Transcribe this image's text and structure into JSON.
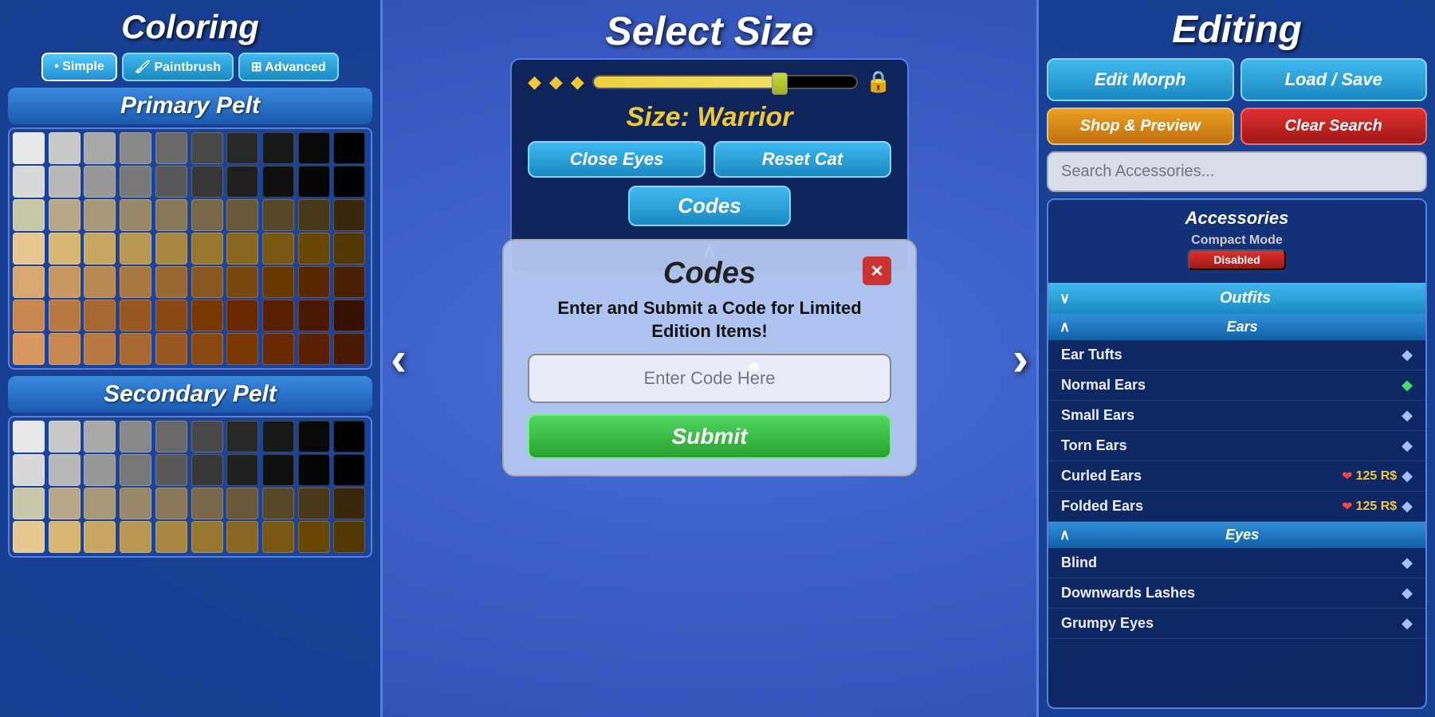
{
  "left_panel": {
    "title": "Coloring",
    "buttons": [
      {
        "label": "• Simple",
        "active": true
      },
      {
        "label": "🖌 Paintbrush",
        "active": false
      },
      {
        "label": "⊞ Advanced",
        "active": false
      }
    ],
    "primary_pelt": {
      "title": "Primary Pelt",
      "colors": [
        "#e8e8e8",
        "#c8c8c8",
        "#a8a8a8",
        "#888",
        "#686868",
        "#484848",
        "#282828",
        "#181818",
        "#080808",
        "#000",
        "#d8d8d8",
        "#b8b8b8",
        "#989898",
        "#787878",
        "#585858",
        "#383838",
        "#202020",
        "#101010",
        "#050505",
        "#000",
        "#c8c8a8",
        "#b8a888",
        "#a89878",
        "#988868",
        "#887858",
        "#786848",
        "#685838",
        "#584828",
        "#483818",
        "#382808",
        "#e8c890",
        "#d8b870",
        "#c8a860",
        "#b89850",
        "#a88840",
        "#987830",
        "#886820",
        "#785810",
        "#684800",
        "#503800",
        "#d8a870",
        "#c89860",
        "#b88850",
        "#a87840",
        "#986830",
        "#885820",
        "#784810",
        "#683800",
        "#582800",
        "#482000",
        "#c88850",
        "#b87840",
        "#a86830",
        "#985820",
        "#884810",
        "#783800",
        "#682800",
        "#582000",
        "#481800",
        "#381000",
        "#d89860",
        "#c88850",
        "#b87840",
        "#a86830",
        "#985820",
        "#884810",
        "#783800",
        "#682800",
        "#582000",
        "#481800"
      ]
    },
    "secondary_pelt": {
      "title": "Secondary Pelt",
      "colors": [
        "#e8e8e8",
        "#c8c8c8",
        "#a8a8a8",
        "#888",
        "#686868",
        "#484848",
        "#282828",
        "#181818",
        "#080808",
        "#000",
        "#d8d8d8",
        "#b8b8b8",
        "#989898",
        "#787878",
        "#585858",
        "#383838",
        "#202020",
        "#101010",
        "#050505",
        "#000"
      ]
    }
  },
  "center_panel": {
    "select_size_title": "Select Size",
    "size_label": "Size: Warrior",
    "close_eyes_btn": "Close Eyes",
    "reset_cat_btn": "Reset Cat",
    "codes_btn": "Codes",
    "collapse_arrow": "∧"
  },
  "codes_modal": {
    "title": "Codes",
    "description": "Enter and Submit a Code for Limited Edition Items!",
    "input_placeholder": "Enter Code Here",
    "submit_btn": "Submit",
    "close_btn": "✕"
  },
  "right_panel": {
    "title": "Editing",
    "edit_morph_btn": "Edit Morph",
    "load_save_btn": "Load / Save",
    "shop_preview_btn": "Shop & Preview",
    "clear_search_btn": "Clear Search",
    "search_placeholder": "Search Accessories...",
    "accessories": {
      "title": "Accessories",
      "compact_mode_label": "Compact Mode",
      "compact_mode_status": "Disabled",
      "categories": [
        {
          "label": "Outfits",
          "expanded": true,
          "arrow": "∨"
        },
        {
          "label": "Ears",
          "expanded": true,
          "arrow": "∧",
          "items": [
            {
              "name": "Ear Tufts",
              "icon": "diamond",
              "owned": false
            },
            {
              "name": "Normal Ears",
              "icon": "diamond-green",
              "owned": true
            },
            {
              "name": "Small Ears",
              "icon": "diamond",
              "owned": false
            },
            {
              "name": "Torn Ears",
              "icon": "diamond",
              "owned": false
            },
            {
              "name": "Curled Ears",
              "icon": "diamond",
              "owned": false,
              "price": "125 R$",
              "locked": true
            },
            {
              "name": "Folded Ears",
              "icon": "diamond",
              "owned": false,
              "price": "125 R$",
              "locked": true
            }
          ]
        },
        {
          "label": "Eyes",
          "expanded": true,
          "arrow": "∧",
          "items": [
            {
              "name": "Blind",
              "icon": "diamond",
              "owned": false
            },
            {
              "name": "Downwards Lashes",
              "icon": "diamond",
              "owned": false
            },
            {
              "name": "Grumpy Eyes",
              "icon": "diamond",
              "owned": false
            }
          ]
        }
      ]
    }
  }
}
